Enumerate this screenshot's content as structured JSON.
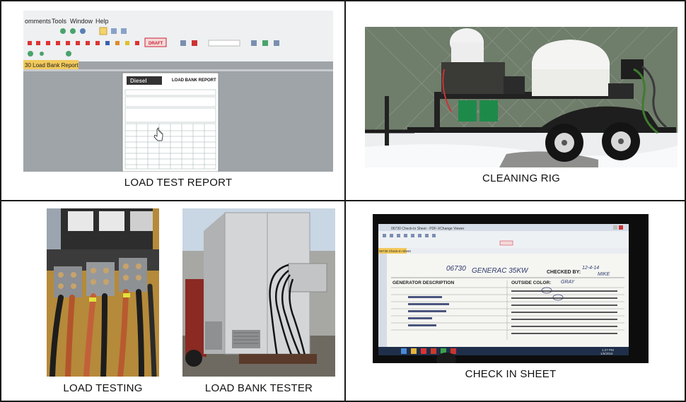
{
  "panels": {
    "load_test_report": {
      "caption": "LOAD TEST REPORT",
      "menu_items": [
        "omments",
        "Tools",
        "Window",
        "Help"
      ],
      "tab_label": "30 Load Bank Report",
      "draft_stamp": "DRAFT",
      "report_title": "LOAD BANK REPORT",
      "report_logo": "Diesel"
    },
    "cleaning_rig": {
      "caption": "CLEANING RIG"
    },
    "load_testing": {
      "caption": "LOAD TESTING"
    },
    "load_bank_tester": {
      "caption": "LOAD BANK TESTER"
    },
    "check_in_sheet": {
      "caption": "CHECK IN SHEET",
      "window_title": "06730 Check-In Sheet - PDF-XChange Viewer",
      "tab_label": "06730 Check-In Sheet",
      "generator_id": "06730",
      "generator_model": "GENERAC 35KW",
      "checked_by_label": "CHECKED BY:",
      "checked_by_value": "MIKE",
      "date_written": "12-4-14",
      "section_generator": "GENERATOR DESCRIPTION",
      "outside_color_label": "OUTSIDE COLOR:",
      "outside_color_value": "GRAY",
      "clock_time": "1:27 PM",
      "clock_date": "1/6/2016"
    }
  }
}
